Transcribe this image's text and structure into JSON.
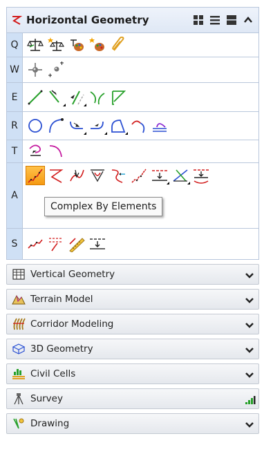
{
  "header": {
    "title": "Horizontal Geometry"
  },
  "rows": [
    {
      "key": "Q"
    },
    {
      "key": "W"
    },
    {
      "key": "E"
    },
    {
      "key": "R"
    },
    {
      "key": "T"
    },
    {
      "key": "A"
    },
    {
      "key": "S"
    }
  ],
  "tooltip": {
    "text": "Complex By Elements"
  },
  "sections": [
    {
      "label": "Vertical Geometry",
      "icon": "vertical-geometry-icon"
    },
    {
      "label": "Terrain Model",
      "icon": "terrain-model-icon"
    },
    {
      "label": "Corridor Modeling",
      "icon": "corridor-modeling-icon"
    },
    {
      "label": "3D Geometry",
      "icon": "3d-geometry-icon"
    },
    {
      "label": "Civil Cells",
      "icon": "civil-cells-icon"
    },
    {
      "label": "Survey",
      "icon": "survey-icon"
    },
    {
      "label": "Drawing",
      "icon": "drawing-icon"
    }
  ],
  "colors": {
    "header_bg": "#dfe8f5",
    "key_bg": "#cfe0f5",
    "selected_tool": "#f59a12",
    "element_red": "#d21c1c",
    "element_green": "#27a02a"
  }
}
